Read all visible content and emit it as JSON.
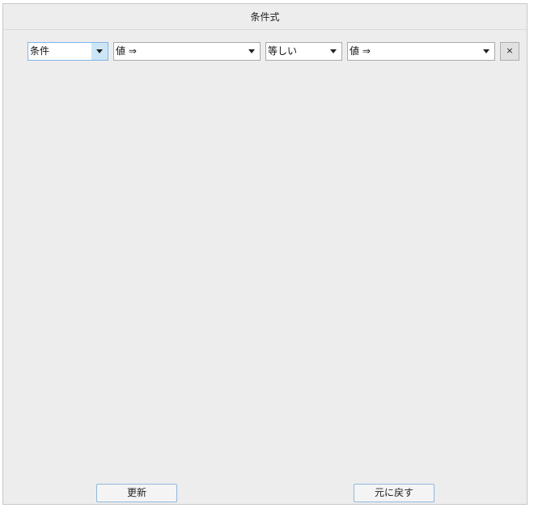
{
  "window": {
    "title": "条件式"
  },
  "condition_row": {
    "condition_select": {
      "value": "条件"
    },
    "left_value_select": {
      "value": "値 ⇒"
    },
    "operator_select": {
      "value": "等しい"
    },
    "right_value_select": {
      "value": "値 ⇒"
    },
    "remove_label": "×"
  },
  "footer": {
    "update_label": "更新",
    "revert_label": "元に戻す"
  },
  "icons": {
    "dropdown": "chevron-down-icon",
    "remove": "close-icon"
  }
}
